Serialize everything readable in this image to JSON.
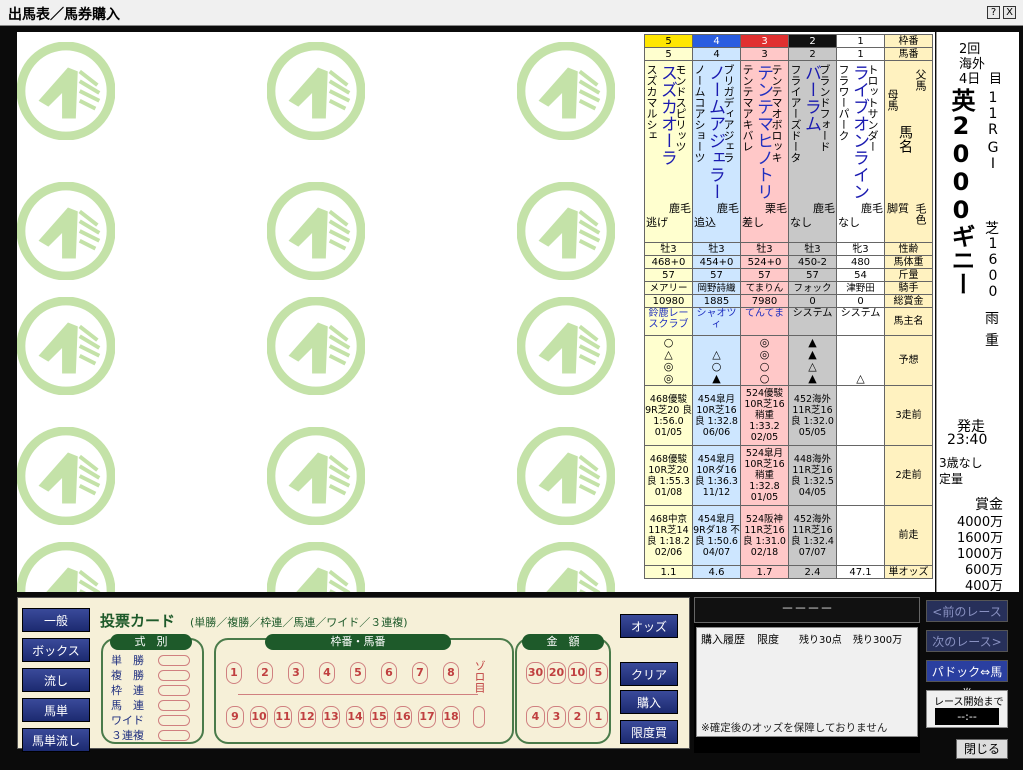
{
  "window": {
    "title": "出馬表／馬券購入",
    "help_label": "?",
    "close_label": "X"
  },
  "race": {
    "kai": "2回",
    "place": "海外",
    "day": "4日",
    "day_suffix": "目",
    "race_no": "11R",
    "grade": "GI",
    "name": "英2000ギニー",
    "surface": "芝",
    "distance": "1600",
    "weather": "雨",
    "going": "重",
    "start_label": "発走",
    "start_time": "23:40",
    "condition1": "3歳なし",
    "condition2": "定量",
    "prize_label": "賞金",
    "prizes": [
      "4000万",
      "1600万",
      "1000万",
      "600万",
      "400万"
    ]
  },
  "labels": {
    "waku": "枠番",
    "umaban": "馬番",
    "father": "父馬",
    "mother": "母馬",
    "horse_name": "馬名",
    "style": "脚質",
    "coat": "毛色",
    "age": "性齢",
    "weight": "馬体重",
    "kinryo": "斤量",
    "jockey": "騎手",
    "earnings": "総賞金",
    "owner": "馬主名",
    "prediction": "予想",
    "p3": "3走前",
    "p2": "2走前",
    "p1": "前走",
    "odds": "単オッズ"
  },
  "horses": [
    {
      "waku": "5",
      "umaban": "5",
      "father": "モンドスピリッツ",
      "name": "スズカオーラ",
      "mother": "スズカマルシェ",
      "coat": "鹿毛",
      "style": "逃げ",
      "age": "牡3",
      "weight": "468+0",
      "kinryo": "57",
      "jockey": "メアリー",
      "earnings": "10980",
      "owner1": "鈴鹿レー",
      "owner2": "スクラブ",
      "pred": [
        "○",
        "△",
        "◎",
        "◎"
      ],
      "p3": "468優駿 9R芝20 良 1:56.0 01/05",
      "p2": "468優駿 10R芝20 良 1:55.3 01/08",
      "p1": "468中京 11R芝14 良 1:18.2 02/06",
      "odds": "1.1"
    },
    {
      "waku": "4",
      "umaban": "4",
      "father": "ブリガディアジェラ",
      "name": "ノームアジェラー",
      "mother": "ノームコアショーツ",
      "coat": "鹿毛",
      "style": "追込",
      "age": "牡3",
      "weight": "454+0",
      "kinryo": "57",
      "jockey": "岡野詩織",
      "earnings": "1885",
      "owner1": "シャオツ",
      "owner2": "ィ",
      "pred": [
        "",
        "△",
        "○",
        "▲"
      ],
      "p3": "454皐月 10R芝16 良 1:32.8 06/06",
      "p2": "454皐月 10Rダ16 良 1:36.3 11/12",
      "p1": "454皐月 9Rダ18 不良 1:50.6 04/07",
      "odds": "4.6"
    },
    {
      "waku": "3",
      "umaban": "3",
      "father": "テンテマオボロッキ",
      "name": "テンテマヒノトリ",
      "mother": "テンテマアキバレ",
      "coat": "栗毛",
      "style": "差し",
      "age": "牡3",
      "weight": "524+0",
      "kinryo": "57",
      "jockey": "てまりん",
      "earnings": "7980",
      "owner1": "てんてま",
      "owner2": "",
      "pred": [
        "◎",
        "◎",
        "○",
        "○"
      ],
      "p3": "524優駿 10R芝16 稍重 1:33.2 02/05",
      "p2": "524皐月 10R芝16 稍重 1:32.8 01/05",
      "p1": "524阪神 11R芝16 良 1:31.0 02/18",
      "odds": "1.7"
    },
    {
      "waku": "2",
      "umaban": "2",
      "father": "ブランドフォード",
      "name": "バーラム",
      "mother": "フライアーズドータ",
      "coat": "鹿毛",
      "style": "なし",
      "age": "牡3",
      "weight": "450-2",
      "kinryo": "57",
      "jockey": "フォック",
      "earnings": "0",
      "owner1": "システム",
      "owner2": "",
      "pred": [
        "▲",
        "▲",
        "△",
        "▲"
      ],
      "p3": "452海外 11R芝16 良 1:32.0 05/05",
      "p2": "448海外 11R芝16 良 1:32.5 04/05",
      "p1": "452海外 11R芝16 良 1:32.4 07/07",
      "odds": "2.4"
    },
    {
      "waku": "1",
      "umaban": "1",
      "father": "トロットサンダー",
      "name": "ライブオンライン",
      "mother": "フラワーパーク",
      "coat": "鹿毛",
      "style": "なし",
      "age": "牝3",
      "weight": "480",
      "kinryo": "54",
      "jockey": "津野田",
      "earnings": "0",
      "owner1": "システム",
      "owner2": "",
      "pred": [
        "",
        "",
        "",
        "△"
      ],
      "p3": "",
      "p2": "",
      "p1": "",
      "odds": "47.1"
    }
  ],
  "bottom": {
    "card_title": "投票カード",
    "card_sub": "(単勝／複勝／枠連／馬連／ワイド／３連複)",
    "left_buttons": [
      "一般",
      "ボックス",
      "流し",
      "馬単",
      "馬単流し"
    ],
    "right_buttons": [
      "オッズ",
      "クリア",
      "購入",
      "限度買"
    ],
    "shiki_head": "式　別",
    "types": [
      "単　勝",
      "複　勝",
      "枠　連",
      "馬　連",
      "ワイド",
      "３連複"
    ],
    "waku_head": "枠番・馬番",
    "nums_top": [
      "1",
      "2",
      "3",
      "4",
      "5",
      "6",
      "7",
      "8"
    ],
    "nums_bot": [
      "9",
      "10",
      "11",
      "12",
      "13",
      "14",
      "15",
      "16",
      "17",
      "18"
    ],
    "zoro": "ゾロ目",
    "amount_head": "金　額",
    "amt_top": [
      "30",
      "20",
      "10",
      "5"
    ],
    "amt_bot": [
      "4",
      "3",
      "2",
      "1"
    ]
  },
  "history": {
    "header": "－－－－",
    "title": "購入履歴",
    "limit": "限度",
    "remain_pts": "残り30点",
    "remain_money": "残り300万",
    "note": "※確定後のオッズを保障しておりません"
  },
  "nav": {
    "prev": "<前のレース",
    "next": "次のレース>",
    "paddock": "パドック⇔馬券",
    "until_label": "レース開始まで",
    "until_value": "--:--",
    "close": "閉じる"
  }
}
